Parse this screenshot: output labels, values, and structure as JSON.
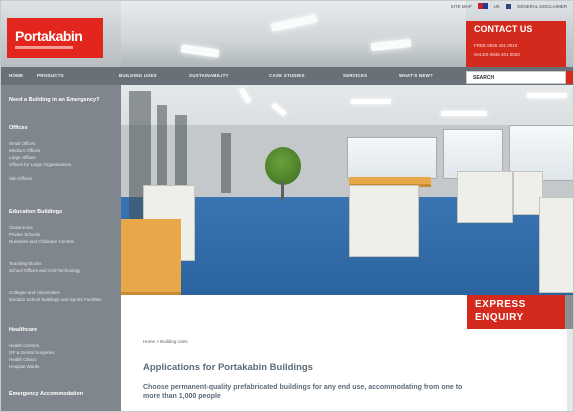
{
  "utility": {
    "links": [
      "SITE MAP",
      "UK",
      "GENERAL DISCLAIMER"
    ]
  },
  "logo": {
    "text": "Portakabin"
  },
  "contact": {
    "title": "CONTACT US",
    "line1": "FREE  0845 401 0010",
    "line2": "SALES  0845 401 0020"
  },
  "nav": {
    "items": [
      "HOME",
      "PRODUCTS",
      "BUILDING USES",
      "SUSTAINABILITY",
      "CASE STUDIES",
      "SERVICES",
      "WHAT'S NEW?"
    ],
    "search_label": "SEARCH"
  },
  "sidebar": {
    "emergency": "Need a Building in an Emergency?",
    "sections": [
      {
        "heading": "Offices",
        "items": [
          "Small Offices",
          "Medium Offices",
          "Large Offices",
          "Offices for Large Organisations",
          "Site Offices"
        ]
      },
      {
        "heading": "Education Buildings",
        "items": [
          "Classrooms",
          "Private Schools",
          "Nurseries and Childcare Centres",
          "Teaching Blocks",
          "School Offices and Civil Technology",
          "Colleges and Universities",
          "Modular School Buildings and Sports Facilities"
        ]
      },
      {
        "heading": "Healthcare",
        "items": [
          "Health Centres",
          "GP & Dental Surgeries",
          "Health Clinics",
          "Hospital Wards"
        ]
      },
      {
        "heading": "Emergency Accommodation",
        "items": []
      }
    ]
  },
  "express": {
    "line1": "EXPRESS",
    "line2": "ENQUIRY"
  },
  "content": {
    "breadcrumb": "Home > Building Uses",
    "title": "Applications for Portakabin Buildings",
    "subtitle": "Choose permanent-quality prefabricated buildings for any end use, accommodating from one to more than 1,000 people"
  },
  "colors": {
    "brand_red": "#d42a1e",
    "nav_gray": "#6a7078",
    "sidebar_gray": "#80868d"
  }
}
